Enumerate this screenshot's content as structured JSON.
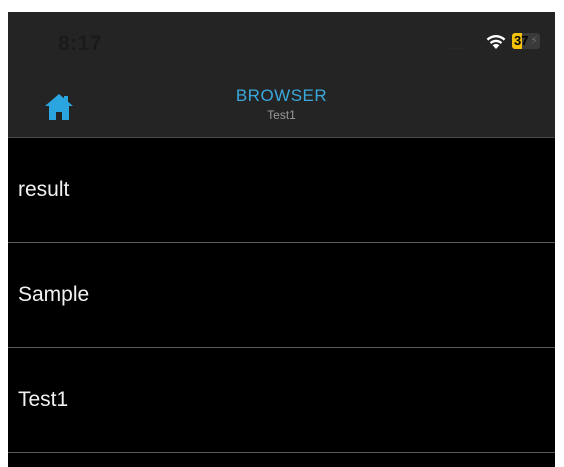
{
  "status_bar": {
    "time": "8:17",
    "signal": "....",
    "battery_level": "37",
    "battery_charge_fraction": 0.37,
    "battery_color": "#f4c20d"
  },
  "nav_bar": {
    "home_icon": "home-icon",
    "title": "BROWSER",
    "subtitle": "Test1",
    "accent_color": "#3aa8dc"
  },
  "list": {
    "items": [
      {
        "label": "result"
      },
      {
        "label": "Sample"
      },
      {
        "label": "Test1"
      }
    ]
  }
}
